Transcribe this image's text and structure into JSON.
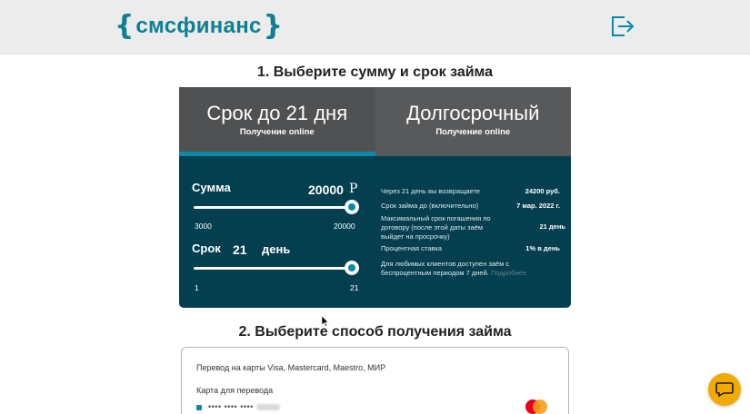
{
  "header": {
    "logo": {
      "left_brace": "{",
      "brand": "смсфинанс",
      "right_brace": "}"
    },
    "logout_icon": "logout-icon"
  },
  "step1": {
    "title": "1. Выберите сумму и срок займа"
  },
  "tabs": [
    {
      "label": "Срок до 21 дня",
      "sub": "Получение online",
      "active": true
    },
    {
      "label": "Долгосрочный",
      "sub": "Получение online",
      "active": false
    }
  ],
  "calculator": {
    "amount": {
      "label": "Сумма",
      "value": "20000",
      "currency": "Р",
      "min": "3000",
      "max": "20000",
      "fraction": 1.0
    },
    "term": {
      "label": "Срок",
      "value": "21",
      "unit": "день",
      "min": "1",
      "max": "21",
      "fraction": 1.0
    },
    "info": [
      {
        "label": "Через 21 день вы возвращаете",
        "value": "24200 руб."
      },
      {
        "label": "Срок займа до (включительно)",
        "value": "7 мар. 2022 г."
      },
      {
        "label": "Максимальный срок погашения по договору (после этой даты заём выйдет на просрочку)",
        "value": "21 день"
      },
      {
        "label": "Процентная ставка",
        "value": "1% в день"
      }
    ],
    "promo": {
      "text": "Для любимых клиентов доступен заём с беспроцентным периодом 7 дней.",
      "link": "Подробнее"
    }
  },
  "step2": {
    "title": "2. Выберите способ получения займа"
  },
  "payout": {
    "method": "Перевод на карты Visa, Mastercard, Maestro, МИР",
    "card_label": "Карта для перевода",
    "card_number": "•••• •••• ••••",
    "card_brand_icon": "mastercard-icon"
  },
  "colors": {
    "brand": "#0f7f93",
    "panel": "#033f4f",
    "tab": "#58595b",
    "accent": "#0a8aa8",
    "chat": "#f2a900"
  }
}
